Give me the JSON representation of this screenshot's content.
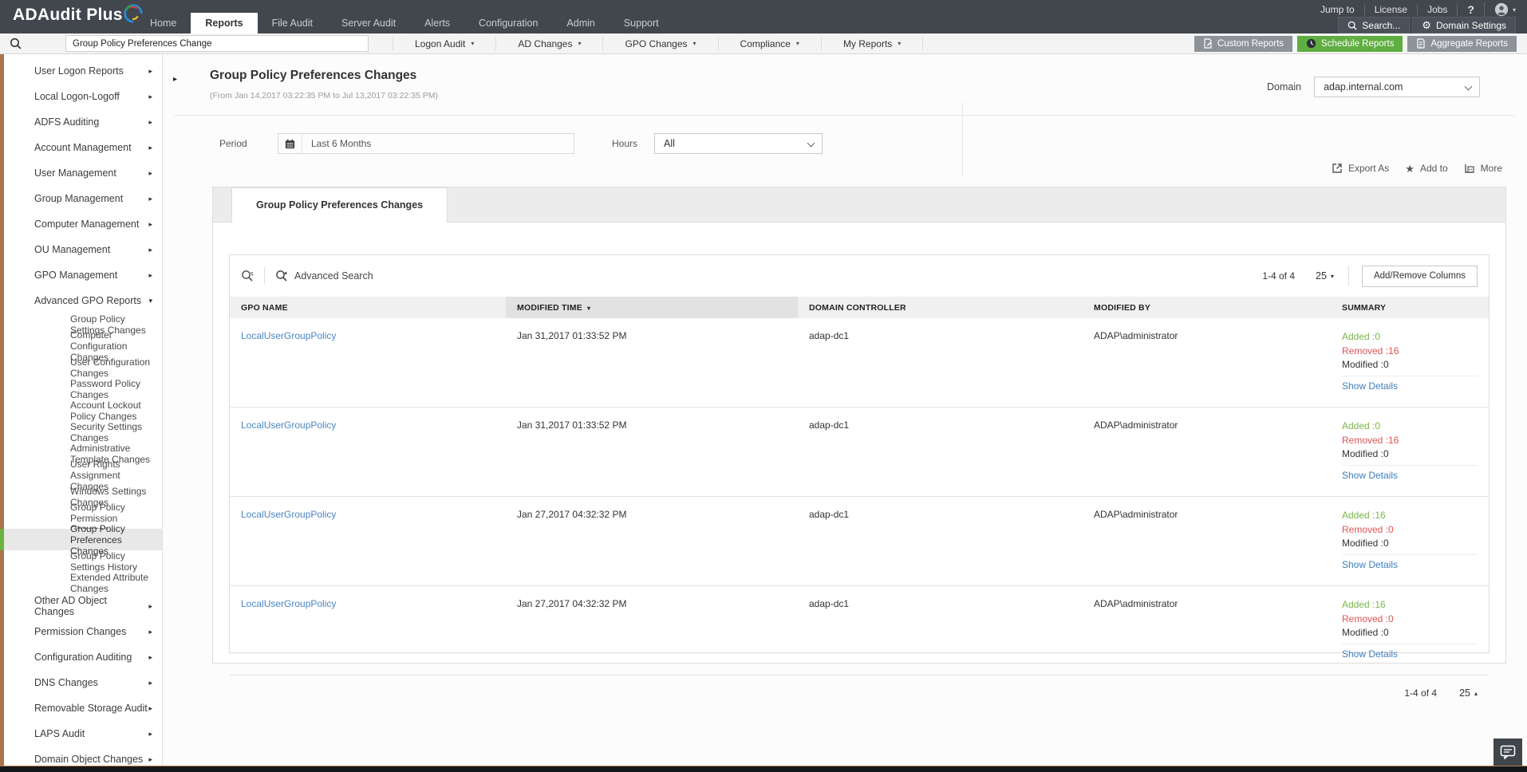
{
  "colors": {
    "topbar_bg": "#42474e",
    "accent_green": "#6cb33f",
    "brand_brown": "#a9734d",
    "link_blue": "#4a86c5",
    "added_green": "#7ab648",
    "removed_red": "#e25352"
  },
  "topbar": {
    "logo": "ADAudit Plus",
    "nav": [
      {
        "label": "Home",
        "active": false
      },
      {
        "label": "Reports",
        "active": true
      },
      {
        "label": "File Audit",
        "active": false
      },
      {
        "label": "Server Audit",
        "active": false
      },
      {
        "label": "Alerts",
        "active": false
      },
      {
        "label": "Configuration",
        "active": false
      },
      {
        "label": "Admin",
        "active": false
      },
      {
        "label": "Support",
        "active": false
      }
    ],
    "links": [
      "Jump to",
      "License",
      "Jobs"
    ],
    "help_label": "?",
    "search_label": "Search...",
    "domain_settings_label": "Domain Settings"
  },
  "toolbar": {
    "search_value": "Group Policy Preferences Change",
    "menus": [
      "Logon Audit",
      "AD Changes",
      "GPO Changes",
      "Compliance",
      "My Reports"
    ],
    "buttons": [
      {
        "label": "Custom Reports",
        "icon": "custom-report-icon",
        "color": "#8d9399"
      },
      {
        "label": "Schedule Reports",
        "icon": "clock-icon",
        "color": "#5fae41"
      },
      {
        "label": "Aggregate Reports",
        "icon": "aggregate-report-icon",
        "color": "#8d9399"
      }
    ]
  },
  "sidebar": {
    "items": [
      {
        "label": "User Logon Reports",
        "level": 1,
        "arrow": "right"
      },
      {
        "label": "Local Logon-Logoff",
        "level": 1,
        "arrow": "right"
      },
      {
        "label": "ADFS Auditing",
        "level": 1,
        "arrow": "right"
      },
      {
        "label": "Account Management",
        "level": 1,
        "arrow": "right"
      },
      {
        "label": "User Management",
        "level": 1,
        "arrow": "right"
      },
      {
        "label": "Group Management",
        "level": 1,
        "arrow": "right"
      },
      {
        "label": "Computer Management",
        "level": 1,
        "arrow": "right"
      },
      {
        "label": "OU Management",
        "level": 1,
        "arrow": "right"
      },
      {
        "label": "GPO Management",
        "level": 1,
        "arrow": "right"
      },
      {
        "label": "Advanced GPO Reports",
        "level": 1,
        "arrow": "down"
      },
      {
        "label": "Group Policy Settings Changes",
        "level": 2
      },
      {
        "label": "Computer Configuration Changes",
        "level": 2
      },
      {
        "label": "User Configuration Changes",
        "level": 2
      },
      {
        "label": "Password Policy Changes",
        "level": 2
      },
      {
        "label": "Account Lockout Policy Changes",
        "level": 2
      },
      {
        "label": "Security Settings Changes",
        "level": 2
      },
      {
        "label": "Administrative Template Changes",
        "level": 2
      },
      {
        "label": "User Rights Assignment Changes",
        "level": 2
      },
      {
        "label": "Windows Settings Changes",
        "level": 2
      },
      {
        "label": "Group Policy Permission Changes",
        "level": 2
      },
      {
        "label": "Group Policy Preferences Changes",
        "level": 2,
        "selected": true
      },
      {
        "label": "Group Policy Settings History",
        "level": 2
      },
      {
        "label": "Extended Attribute Changes",
        "level": 2
      },
      {
        "label": "Other AD Object Changes",
        "level": 1,
        "arrow": "right"
      },
      {
        "label": "Permission Changes",
        "level": 1,
        "arrow": "right"
      },
      {
        "label": "Configuration Auditing",
        "level": 1,
        "arrow": "right"
      },
      {
        "label": "DNS Changes",
        "level": 1,
        "arrow": "right"
      },
      {
        "label": "Removable Storage Audit",
        "level": 1,
        "arrow": "right"
      },
      {
        "label": "LAPS Audit",
        "level": 1,
        "arrow": "right"
      },
      {
        "label": "Domain Object Changes",
        "level": 1,
        "arrow": "right"
      }
    ]
  },
  "report": {
    "title": "Group Policy Preferences Changes",
    "subtitle": "(From Jan 14,2017 03:22:35 PM to Jul 13,2017 03:22:35 PM)",
    "domain_label": "Domain",
    "domain_value": "adap.internal.com",
    "period_label": "Period",
    "period_value": "Last 6 Months",
    "hours_label": "Hours",
    "hours_value": "All",
    "actions": {
      "export_label": "Export As",
      "add_label": "Add to",
      "more_label": "More"
    },
    "tab_label": "Group Policy Preferences Changes"
  },
  "table": {
    "advanced_search_label": "Advanced Search",
    "range_text": "1-4 of 4",
    "page_size": "25",
    "add_remove_label": "Add/Remove Columns",
    "columns": [
      "GPO NAME",
      "MODIFIED TIME",
      "DOMAIN CONTROLLER",
      "MODIFIED BY",
      "SUMMARY"
    ],
    "sorted_column": "MODIFIED TIME",
    "summary_labels": {
      "added": "Added :",
      "removed": "Removed :",
      "modified": "Modified :",
      "details": "Show Details"
    },
    "rows": [
      {
        "gpo": "LocalUserGroupPolicy",
        "modified_time": "Jan 31,2017 01:33:52 PM",
        "domain_controller": "adap-dc1",
        "modified_by": "ADAP\\administrator",
        "added": "0",
        "removed": "16",
        "modified": "0"
      },
      {
        "gpo": "LocalUserGroupPolicy",
        "modified_time": "Jan 31,2017 01:33:52 PM",
        "domain_controller": "adap-dc1",
        "modified_by": "ADAP\\administrator",
        "added": "0",
        "removed": "16",
        "modified": "0"
      },
      {
        "gpo": "LocalUserGroupPolicy",
        "modified_time": "Jan 27,2017 04:32:32 PM",
        "domain_controller": "adap-dc1",
        "modified_by": "ADAP\\administrator",
        "added": "16",
        "removed": "0",
        "modified": "0"
      },
      {
        "gpo": "LocalUserGroupPolicy",
        "modified_time": "Jan 27,2017 04:32:32 PM",
        "domain_controller": "adap-dc1",
        "modified_by": "ADAP\\administrator",
        "added": "16",
        "removed": "0",
        "modified": "0"
      }
    ],
    "footer_range_text": "1-4 of 4",
    "footer_page_size": "25"
  }
}
